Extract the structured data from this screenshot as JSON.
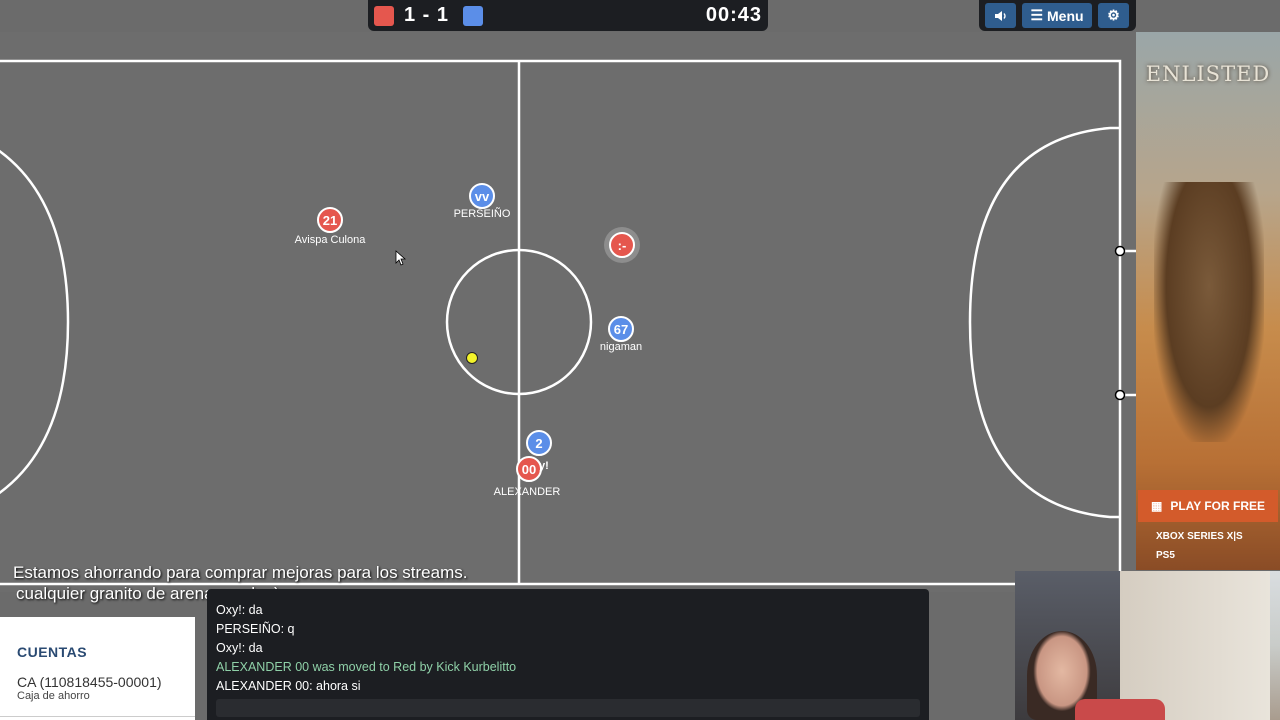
{
  "scoreboard": {
    "red_color": "#e5574e",
    "blue_color": "#5b8ee8",
    "score": "1 - 1",
    "timer": "00:43"
  },
  "controls": {
    "sound_icon": "speaker-icon",
    "menu_label": "Menu",
    "settings_icon": "gear-icon"
  },
  "field": {
    "background": "#6d6d6d",
    "line_color": "#ffffff"
  },
  "players": [
    {
      "team": "red",
      "number": "21",
      "name": "Avispa Culona"
    },
    {
      "team": "blue",
      "number": "vv",
      "name": "PERSEIÑO"
    },
    {
      "team": "red",
      "number": ":-",
      "name": ""
    },
    {
      "team": "blue",
      "number": "67",
      "name": "nigaman"
    },
    {
      "team": "blue",
      "number": "2",
      "name": "",
      "chat": "y!"
    },
    {
      "team": "red",
      "number": "00",
      "name": "ALEXANDER"
    }
  ],
  "overlay": {
    "line1": "Estamos ahorrando para comprar mejoras para los streams.",
    "line2": "cualquier granito de arena ayuda :)"
  },
  "chat": {
    "lines": [
      {
        "text": "Oxy!: da",
        "type": "message"
      },
      {
        "text": "PERSEIÑO: q",
        "type": "message"
      },
      {
        "text": "Oxy!: da",
        "type": "message"
      },
      {
        "text": "ALEXANDER 00 was moved to Red by Kick Kurbelitto",
        "type": "notice"
      },
      {
        "text": "ALEXANDER 00: ahora si",
        "type": "message"
      }
    ]
  },
  "bank": {
    "title": "CUENTAS",
    "account": "CA (110818455-00001)",
    "account_type": "Caja de ahorro"
  },
  "ad": {
    "logo": "ENLISTED",
    "cta": "PLAY FOR FREE",
    "platform1": "XBOX SERIES X|S",
    "platform2": "PS5"
  }
}
